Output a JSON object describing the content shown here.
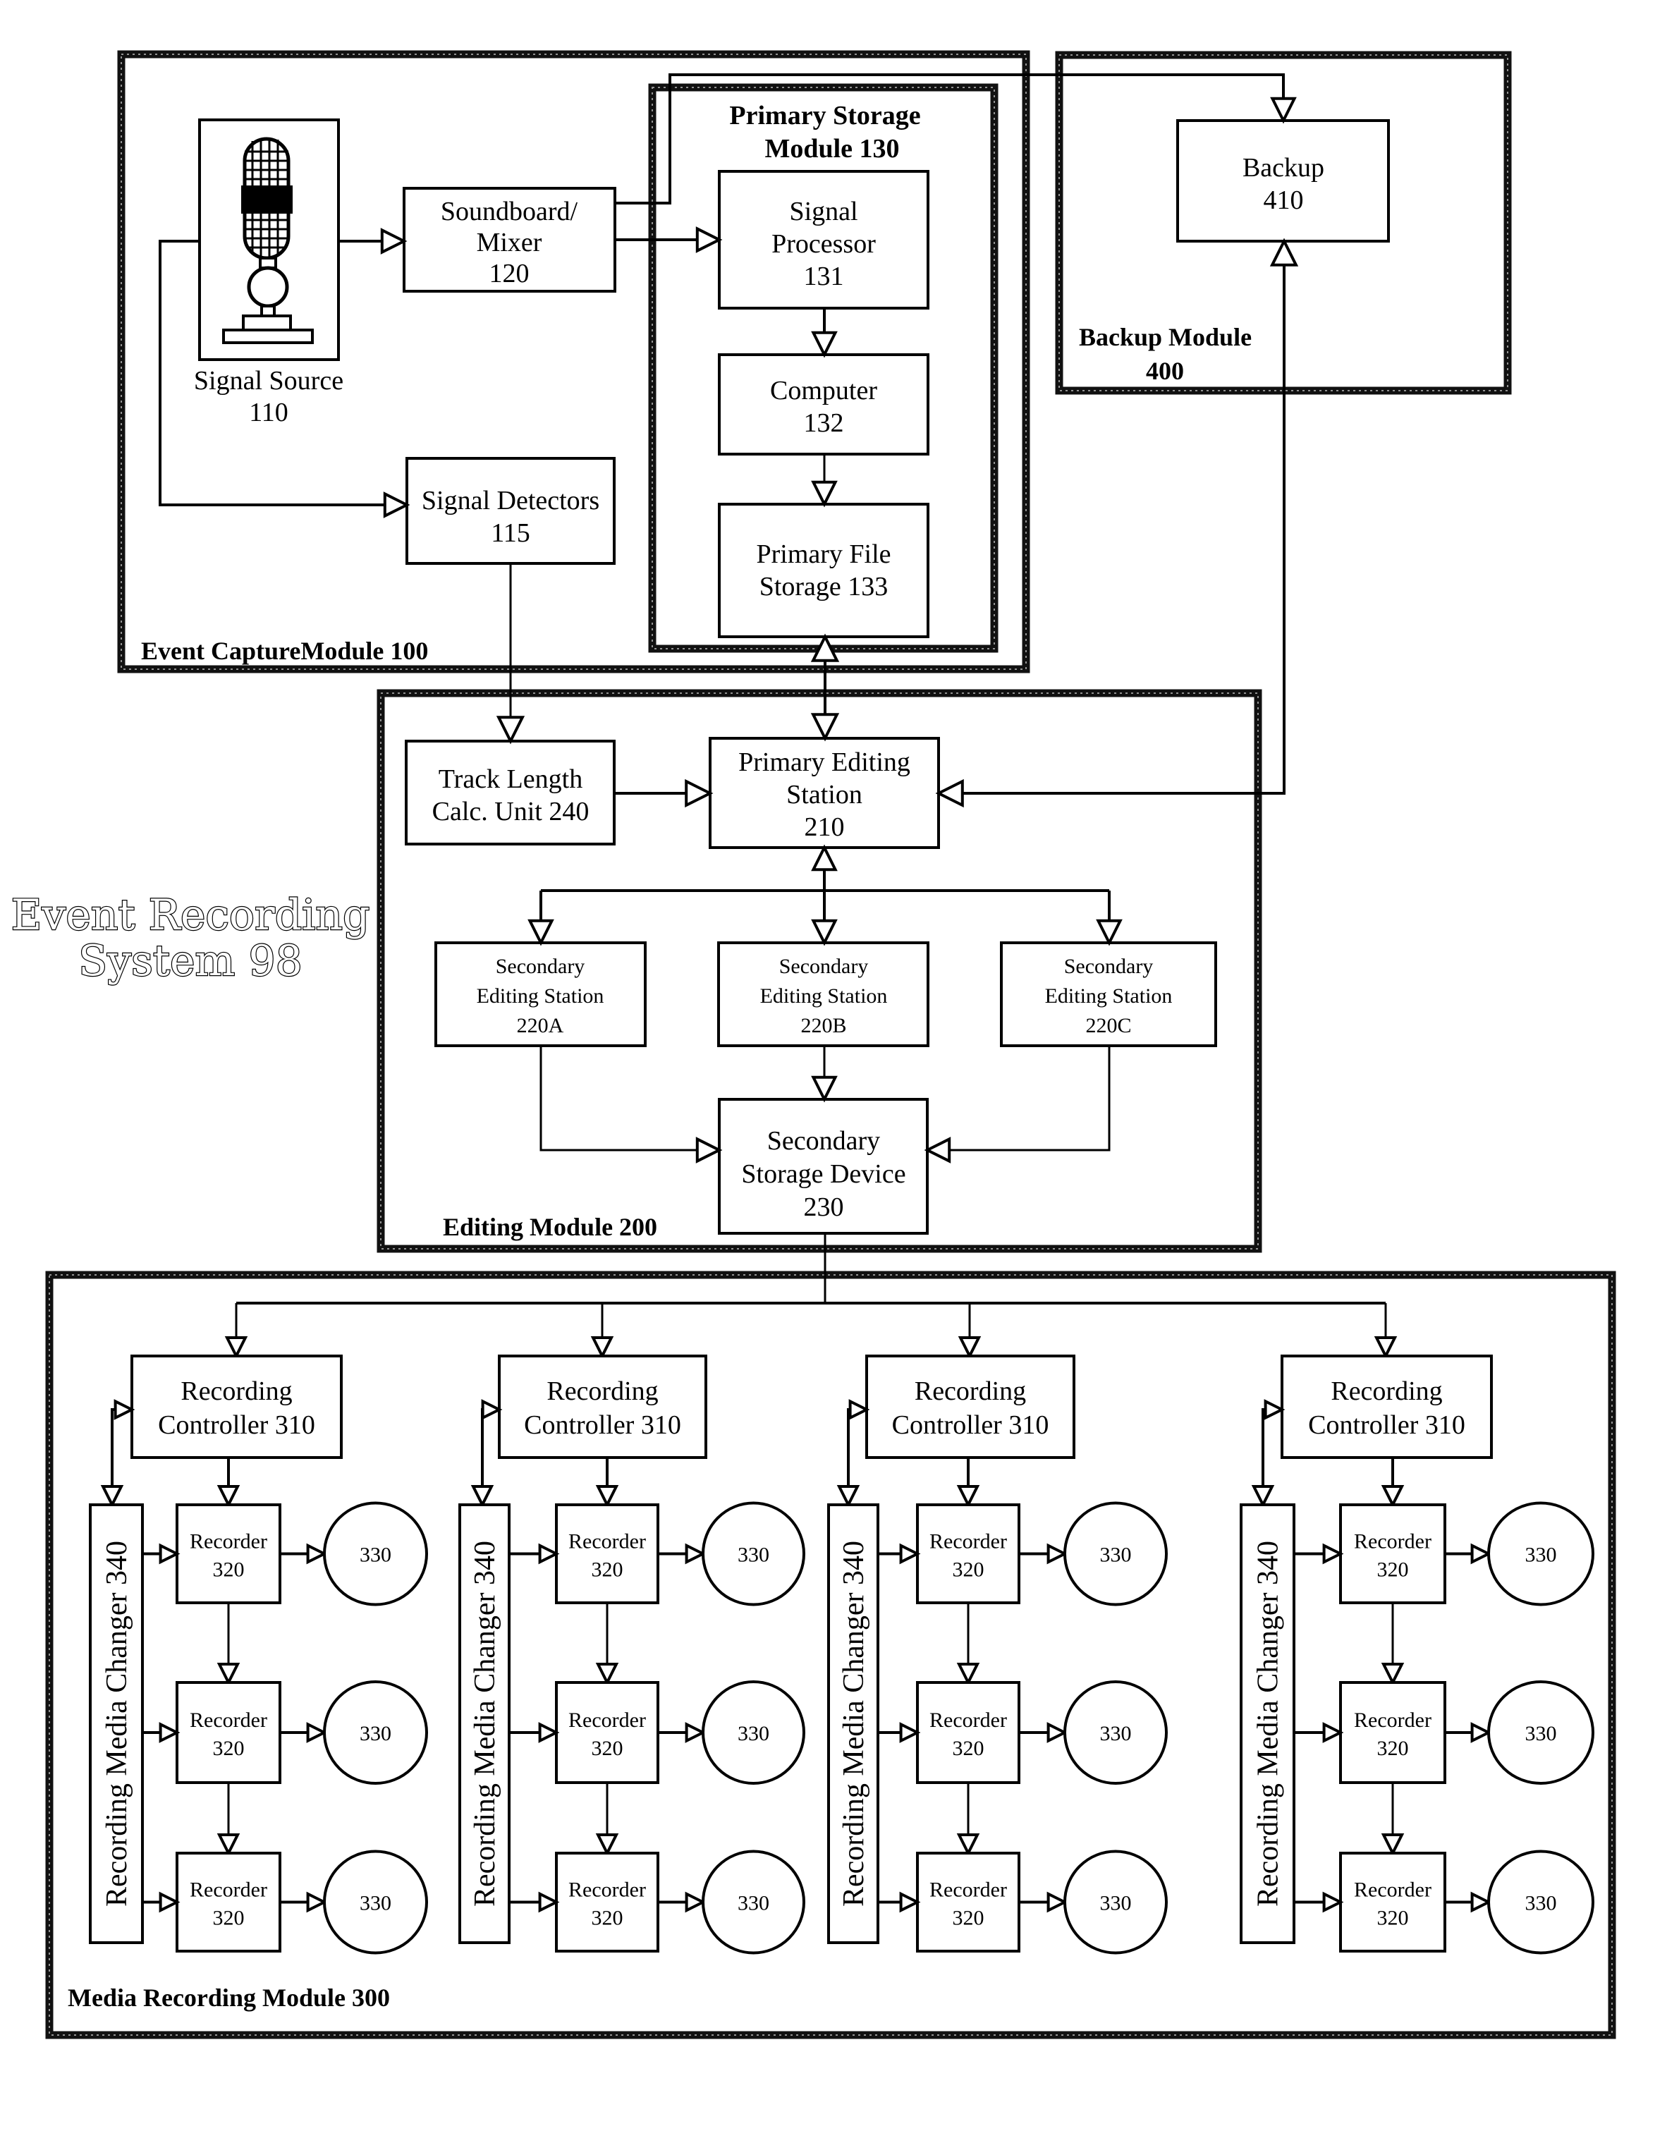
{
  "figure": {
    "title_lines": [
      "Event Recording",
      "System 98"
    ]
  },
  "modules": {
    "event_capture": {
      "label": "Event CaptureModule 100"
    },
    "primary_storage": {
      "label_lines": [
        "Primary Storage",
        "Module 130"
      ]
    },
    "backup": {
      "label_lines": [
        "Backup Module",
        "400"
      ]
    },
    "editing": {
      "label": "Editing Module 200"
    },
    "media_recording": {
      "label": "Media Recording Module 300"
    }
  },
  "blocks": {
    "signal_source": {
      "lines": [
        "Signal Source",
        "110"
      ],
      "icon": "microphone-icon"
    },
    "soundboard": {
      "lines": [
        "Soundboard/",
        "Mixer",
        "120"
      ]
    },
    "signal_detectors": {
      "lines": [
        "Signal Detectors",
        "115"
      ]
    },
    "signal_processor": {
      "lines": [
        "Signal",
        "Processor",
        "131"
      ]
    },
    "computer": {
      "lines": [
        "Computer",
        "132"
      ]
    },
    "primary_file_storage": {
      "lines": [
        "Primary File",
        "Storage 133"
      ]
    },
    "backup": {
      "lines": [
        "Backup",
        "410"
      ]
    },
    "track_length": {
      "lines": [
        "Track Length",
        "Calc. Unit 240"
      ]
    },
    "primary_editing": {
      "lines": [
        "Primary Editing",
        "Station",
        "210"
      ]
    },
    "secondary_a": {
      "lines": [
        "Secondary",
        "Editing Station",
        "220A"
      ]
    },
    "secondary_b": {
      "lines": [
        "Secondary",
        "Editing Station",
        "220B"
      ]
    },
    "secondary_c": {
      "lines": [
        "Secondary",
        "Editing Station",
        "220C"
      ]
    },
    "secondary_storage": {
      "lines": [
        "Secondary",
        "Storage Device",
        "230"
      ]
    }
  },
  "recording_columns": [
    {
      "controller": [
        "Recording",
        "Controller 310"
      ],
      "changer": "Recording Media Changer 340",
      "recorders": [
        [
          "Recorder",
          "320"
        ],
        [
          "Recorder",
          "320"
        ],
        [
          "Recorder",
          "320"
        ]
      ],
      "media": [
        "330",
        "330",
        "330"
      ]
    },
    {
      "controller": [
        "Recording",
        "Controller 310"
      ],
      "changer": "Recording Media Changer 340",
      "recorders": [
        [
          "Recorder",
          "320"
        ],
        [
          "Recorder",
          "320"
        ],
        [
          "Recorder",
          "320"
        ]
      ],
      "media": [
        "330",
        "330",
        "330"
      ]
    },
    {
      "controller": [
        "Recording",
        "Controller 310"
      ],
      "changer": "Recording Media Changer 340",
      "recorders": [
        [
          "Recorder",
          "320"
        ],
        [
          "Recorder",
          "320"
        ],
        [
          "Recorder",
          "320"
        ]
      ],
      "media": [
        "330",
        "330",
        "330"
      ]
    },
    {
      "controller": [
        "Recording",
        "Controller 310"
      ],
      "changer": "Recording Media Changer 340",
      "recorders": [
        [
          "Recorder",
          "320"
        ],
        [
          "Recorder",
          "320"
        ],
        [
          "Recorder",
          "320"
        ]
      ],
      "media": [
        "330",
        "330",
        "330"
      ]
    }
  ]
}
